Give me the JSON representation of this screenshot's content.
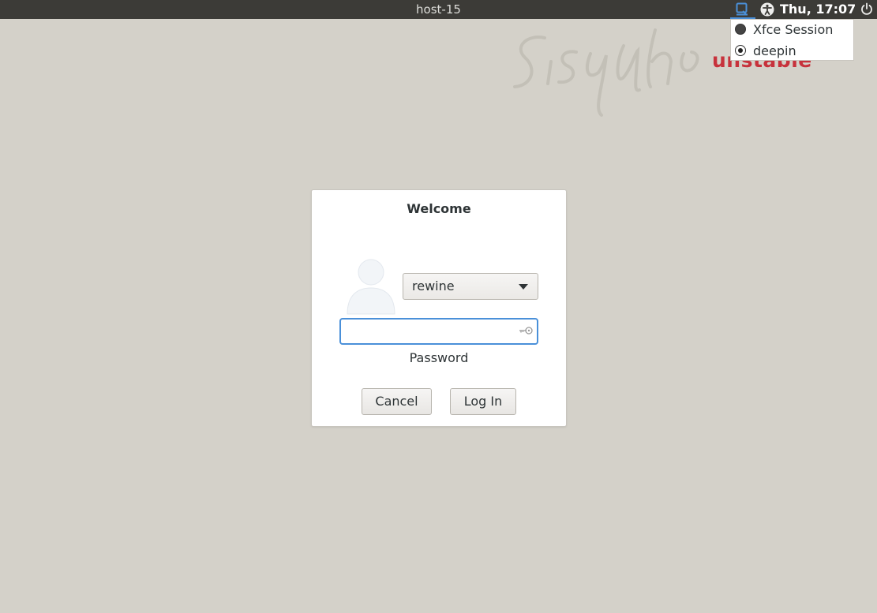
{
  "panel": {
    "hostname": "host-15",
    "clock": "Thu, 17:07",
    "icons": [
      "session-icon",
      "accessibility-icon",
      "power-icon"
    ]
  },
  "session_menu": {
    "items": [
      {
        "label": "Xfce Session",
        "selected": false
      },
      {
        "label": "deepin",
        "selected": true
      }
    ]
  },
  "background": {
    "brand_text": "unstable",
    "brand_color": "#c7323c"
  },
  "dialog": {
    "title": "Welcome",
    "user": "rewine",
    "password_value": "",
    "password_label": "Password",
    "cancel_label": "Cancel",
    "login_label": "Log In"
  },
  "colors": {
    "panel_bg": "#3c3b37",
    "desktop_bg": "#d4d1c9",
    "focus_accent": "#4a90d9"
  }
}
